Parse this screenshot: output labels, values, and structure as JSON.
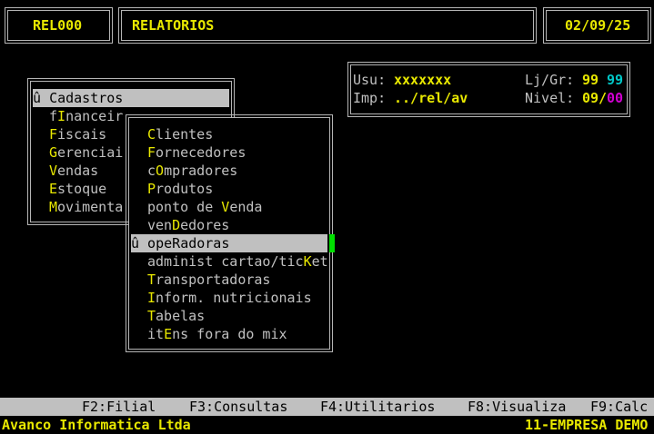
{
  "header": {
    "program_code": "REL000",
    "module_title": "RELATORIOS",
    "date": "02/09/25"
  },
  "info_panel": {
    "user_label": "Usu:",
    "user_value": "xxxxxxx",
    "store_label": "Lj/Gr:",
    "store_value": "99",
    "group_value": "99",
    "printer_label": "Imp:",
    "printer_value": "../rel/av",
    "level_label": "Nivel:",
    "level_value": "09",
    "level_sep": "/",
    "level_sub": "00"
  },
  "main_menu": {
    "items": [
      {
        "pre": "û ",
        "key": "C",
        "post": "adastros",
        "selected": true
      },
      {
        "pre": "f",
        "key": "I",
        "post": "nanceir",
        "selected": false
      },
      {
        "pre": "",
        "key": "F",
        "post": "iscais",
        "selected": false
      },
      {
        "pre": "",
        "key": "G",
        "post": "erenciai",
        "selected": false
      },
      {
        "pre": "",
        "key": "V",
        "post": "endas",
        "selected": false
      },
      {
        "pre": "",
        "key": "E",
        "post": "stoque",
        "selected": false
      },
      {
        "pre": "",
        "key": "M",
        "post": "ovimenta",
        "selected": false
      }
    ]
  },
  "sub_menu": {
    "items": [
      {
        "pre": "",
        "key": "C",
        "post": "lientes",
        "selected": false
      },
      {
        "pre": "",
        "key": "F",
        "post": "ornecedores",
        "selected": false
      },
      {
        "pre": "c",
        "key": "O",
        "post": "mpradores",
        "selected": false
      },
      {
        "pre": "",
        "key": "P",
        "post": "rodutos",
        "selected": false
      },
      {
        "pre": "ponto de ",
        "key": "V",
        "post": "enda",
        "selected": false
      },
      {
        "pre": "ven",
        "key": "D",
        "post": "edores",
        "selected": false
      },
      {
        "pre": "û ope",
        "key": "R",
        "post": "adoras",
        "selected": true
      },
      {
        "pre": "administ cartao/tic",
        "key": "K",
        "post": "et",
        "selected": false
      },
      {
        "pre": "",
        "key": "T",
        "post": "ransportadoras",
        "selected": false
      },
      {
        "pre": "",
        "key": "I",
        "post": "nform. nutricionais",
        "selected": false
      },
      {
        "pre": "",
        "key": "T",
        "post": "abelas",
        "selected": false
      },
      {
        "pre": "it",
        "key": "E",
        "post": "ns fora do mix",
        "selected": false
      }
    ]
  },
  "function_keys": {
    "f2": "F2:Filial",
    "f3": "F3:Consultas",
    "f4": "F4:Utilitarios",
    "f8": "F8:Visualiza",
    "f9": "F9:Calc"
  },
  "status": {
    "company_name": "Avanco Informatica Ltda",
    "enterprise": "11-EMPRESA DEMO"
  }
}
